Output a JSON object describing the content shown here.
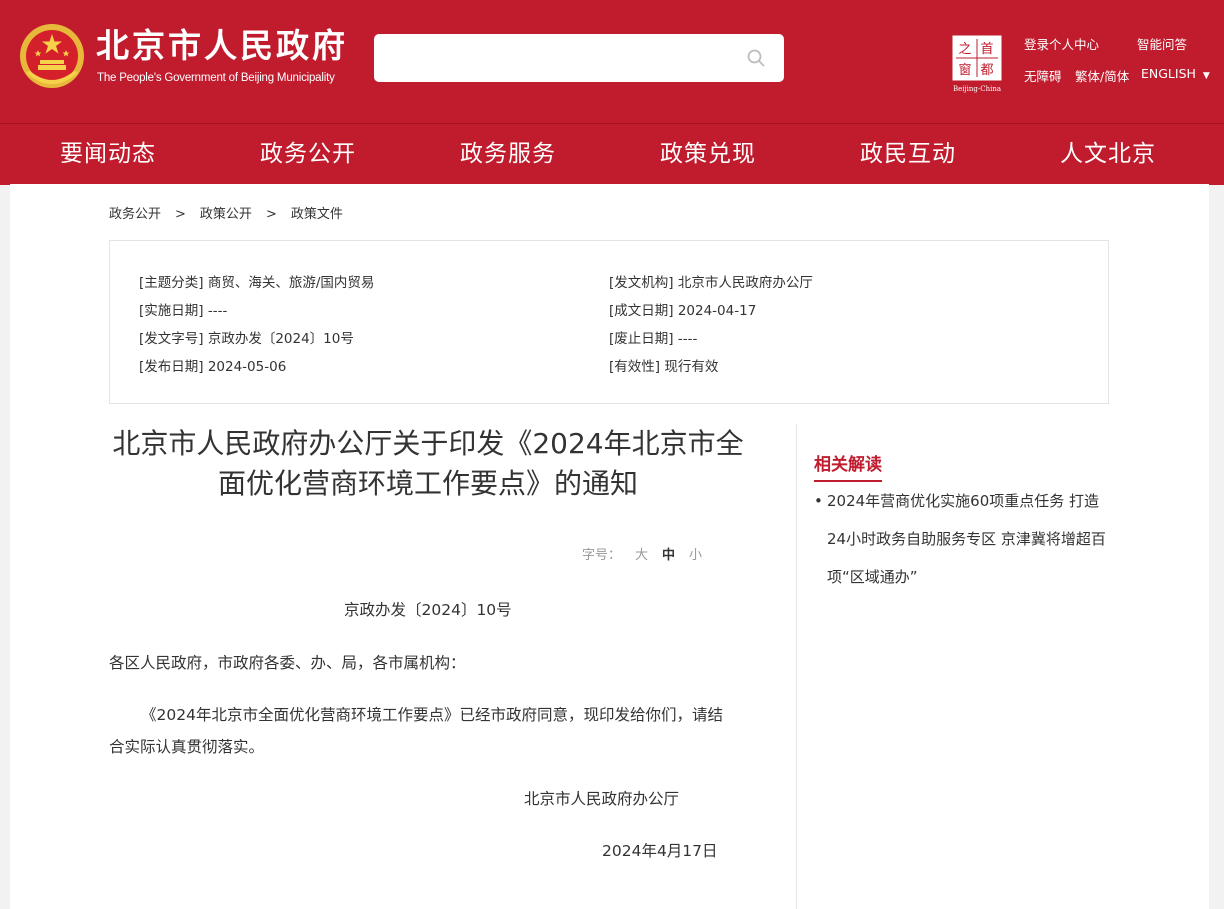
{
  "header": {
    "site_title": "北京市人民政府",
    "site_subtitle": "The People's Government of Beijing Municipality",
    "search_placeholder": "",
    "capital_logo": {
      "chars": [
        "首",
        "都",
        "之",
        "窗"
      ],
      "caption": "Beijing-China"
    },
    "links": {
      "login": "登录",
      "personal_center": "个人中心",
      "smart_qa": "智能问答",
      "accessibility": "无障碍",
      "traditional_simplified": "繁体/简体",
      "english": "ENGLISH"
    },
    "brand_color": "#c01c2e"
  },
  "nav": {
    "items": [
      "要闻动态",
      "政务公开",
      "政务服务",
      "政策兑现",
      "政民互动",
      "人文北京"
    ]
  },
  "breadcrumb": [
    "政务公开",
    "政策公开",
    "政策文件"
  ],
  "meta": {
    "topic": "[主题分类] 商贸、海关、旅游/国内贸易",
    "issuer": "[发文机构] 北京市人民政府办公厅",
    "effective_date": "[实施日期] ----",
    "written_date": "[成文日期] 2024-04-17",
    "doc_number": "[发文字号] 京政办发〔2024〕10号",
    "repeal_date": "[废止日期] ----",
    "publish_date": "[发布日期] 2024-05-06",
    "validity": "[有效性] 现行有效"
  },
  "document": {
    "title_line1": "北京市人民政府办公厅关于印发《2024年北京市全",
    "title_line2": "面优化营商环境工作要点》的通知",
    "fontsize_label": "字号：",
    "fontsize_options": [
      "大",
      "中",
      "小"
    ],
    "doc_number": "京政办发〔2024〕10号",
    "salutation": "各区人民政府，市政府各委、办、局，各市属机构：",
    "body_line1": "《2024年北京市全面优化营商环境工作要点》已经市政府同意，现印发给你们，请结",
    "body_line2": "合实际认真贯彻落实。",
    "signatory": "北京市人民政府办公厅",
    "date": "2024年4月17日"
  },
  "related": {
    "title": "相关解读",
    "items": [
      "2024年营商优化实施60项重点任务 打造24小时政务自助服务专区 京津冀将增超百项“区域通办”"
    ]
  }
}
